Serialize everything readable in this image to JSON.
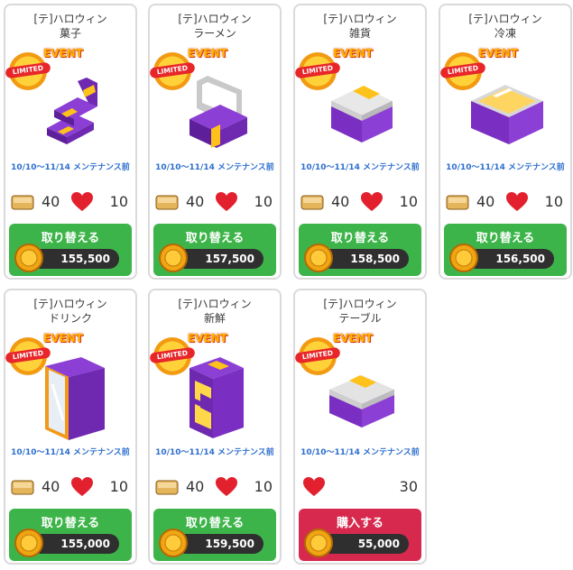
{
  "cards": [
    {
      "title1": "[テ]ハロウィン",
      "title2": "菓子",
      "limited": "LIMITED",
      "event": "EVENT",
      "period": "10/10〜11/14 メンテナンス前",
      "box_val": "40",
      "heart_val": "10",
      "action": "取り替える",
      "price": "155,500",
      "action_type": "green",
      "art": "steps"
    },
    {
      "title1": "[テ]ハロウィン",
      "title2": "ラーメン",
      "limited": "LIMITED",
      "event": "EVENT",
      "period": "10/10〜11/14 メンテナンス前",
      "box_val": "40",
      "heart_val": "10",
      "action": "取り替える",
      "price": "157,500",
      "action_type": "green",
      "art": "chair"
    },
    {
      "title1": "[テ]ハロウィン",
      "title2": "雑貨",
      "limited": "LIMITED",
      "event": "EVENT",
      "period": "10/10〜11/14 メンテナンス前",
      "box_val": "40",
      "heart_val": "10",
      "action": "取り替える",
      "price": "158,500",
      "action_type": "green",
      "art": "crate"
    },
    {
      "title1": "[テ]ハロウィン",
      "title2": "冷凍",
      "limited": "LIMITED",
      "event": "EVENT",
      "period": "10/10〜11/14 メンテナンス前",
      "box_val": "40",
      "heart_val": "10",
      "action": "取り替える",
      "price": "156,500",
      "action_type": "green",
      "art": "freezer"
    },
    {
      "title1": "[テ]ハロウィン",
      "title2": "ドリンク",
      "limited": "LIMITED",
      "event": "EVENT",
      "period": "10/10〜11/14 メンテナンス前",
      "box_val": "40",
      "heart_val": "10",
      "action": "取り替える",
      "price": "155,000",
      "action_type": "green",
      "art": "fridge"
    },
    {
      "title1": "[テ]ハロウィン",
      "title2": "新鮮",
      "limited": "LIMITED",
      "event": "EVENT",
      "period": "10/10〜11/14 メンテナンス前",
      "box_val": "40",
      "heart_val": "10",
      "action": "取り替える",
      "price": "159,500",
      "action_type": "green",
      "art": "showcase"
    },
    {
      "title1": "[テ]ハロウィン",
      "title2": "テーブル",
      "limited": "LIMITED",
      "event": "EVENT",
      "period": "10/10〜11/14 メンテナンス前",
      "box_val": "",
      "heart_val": "30",
      "action": "購入する",
      "price": "55,000",
      "action_type": "pink",
      "art": "table"
    }
  ],
  "colors": {
    "purple": "#7a2fc2",
    "yellow": "#ffc21a",
    "silver": "#d8d8d8",
    "green": "#3db449",
    "pink": "#d6294d"
  }
}
